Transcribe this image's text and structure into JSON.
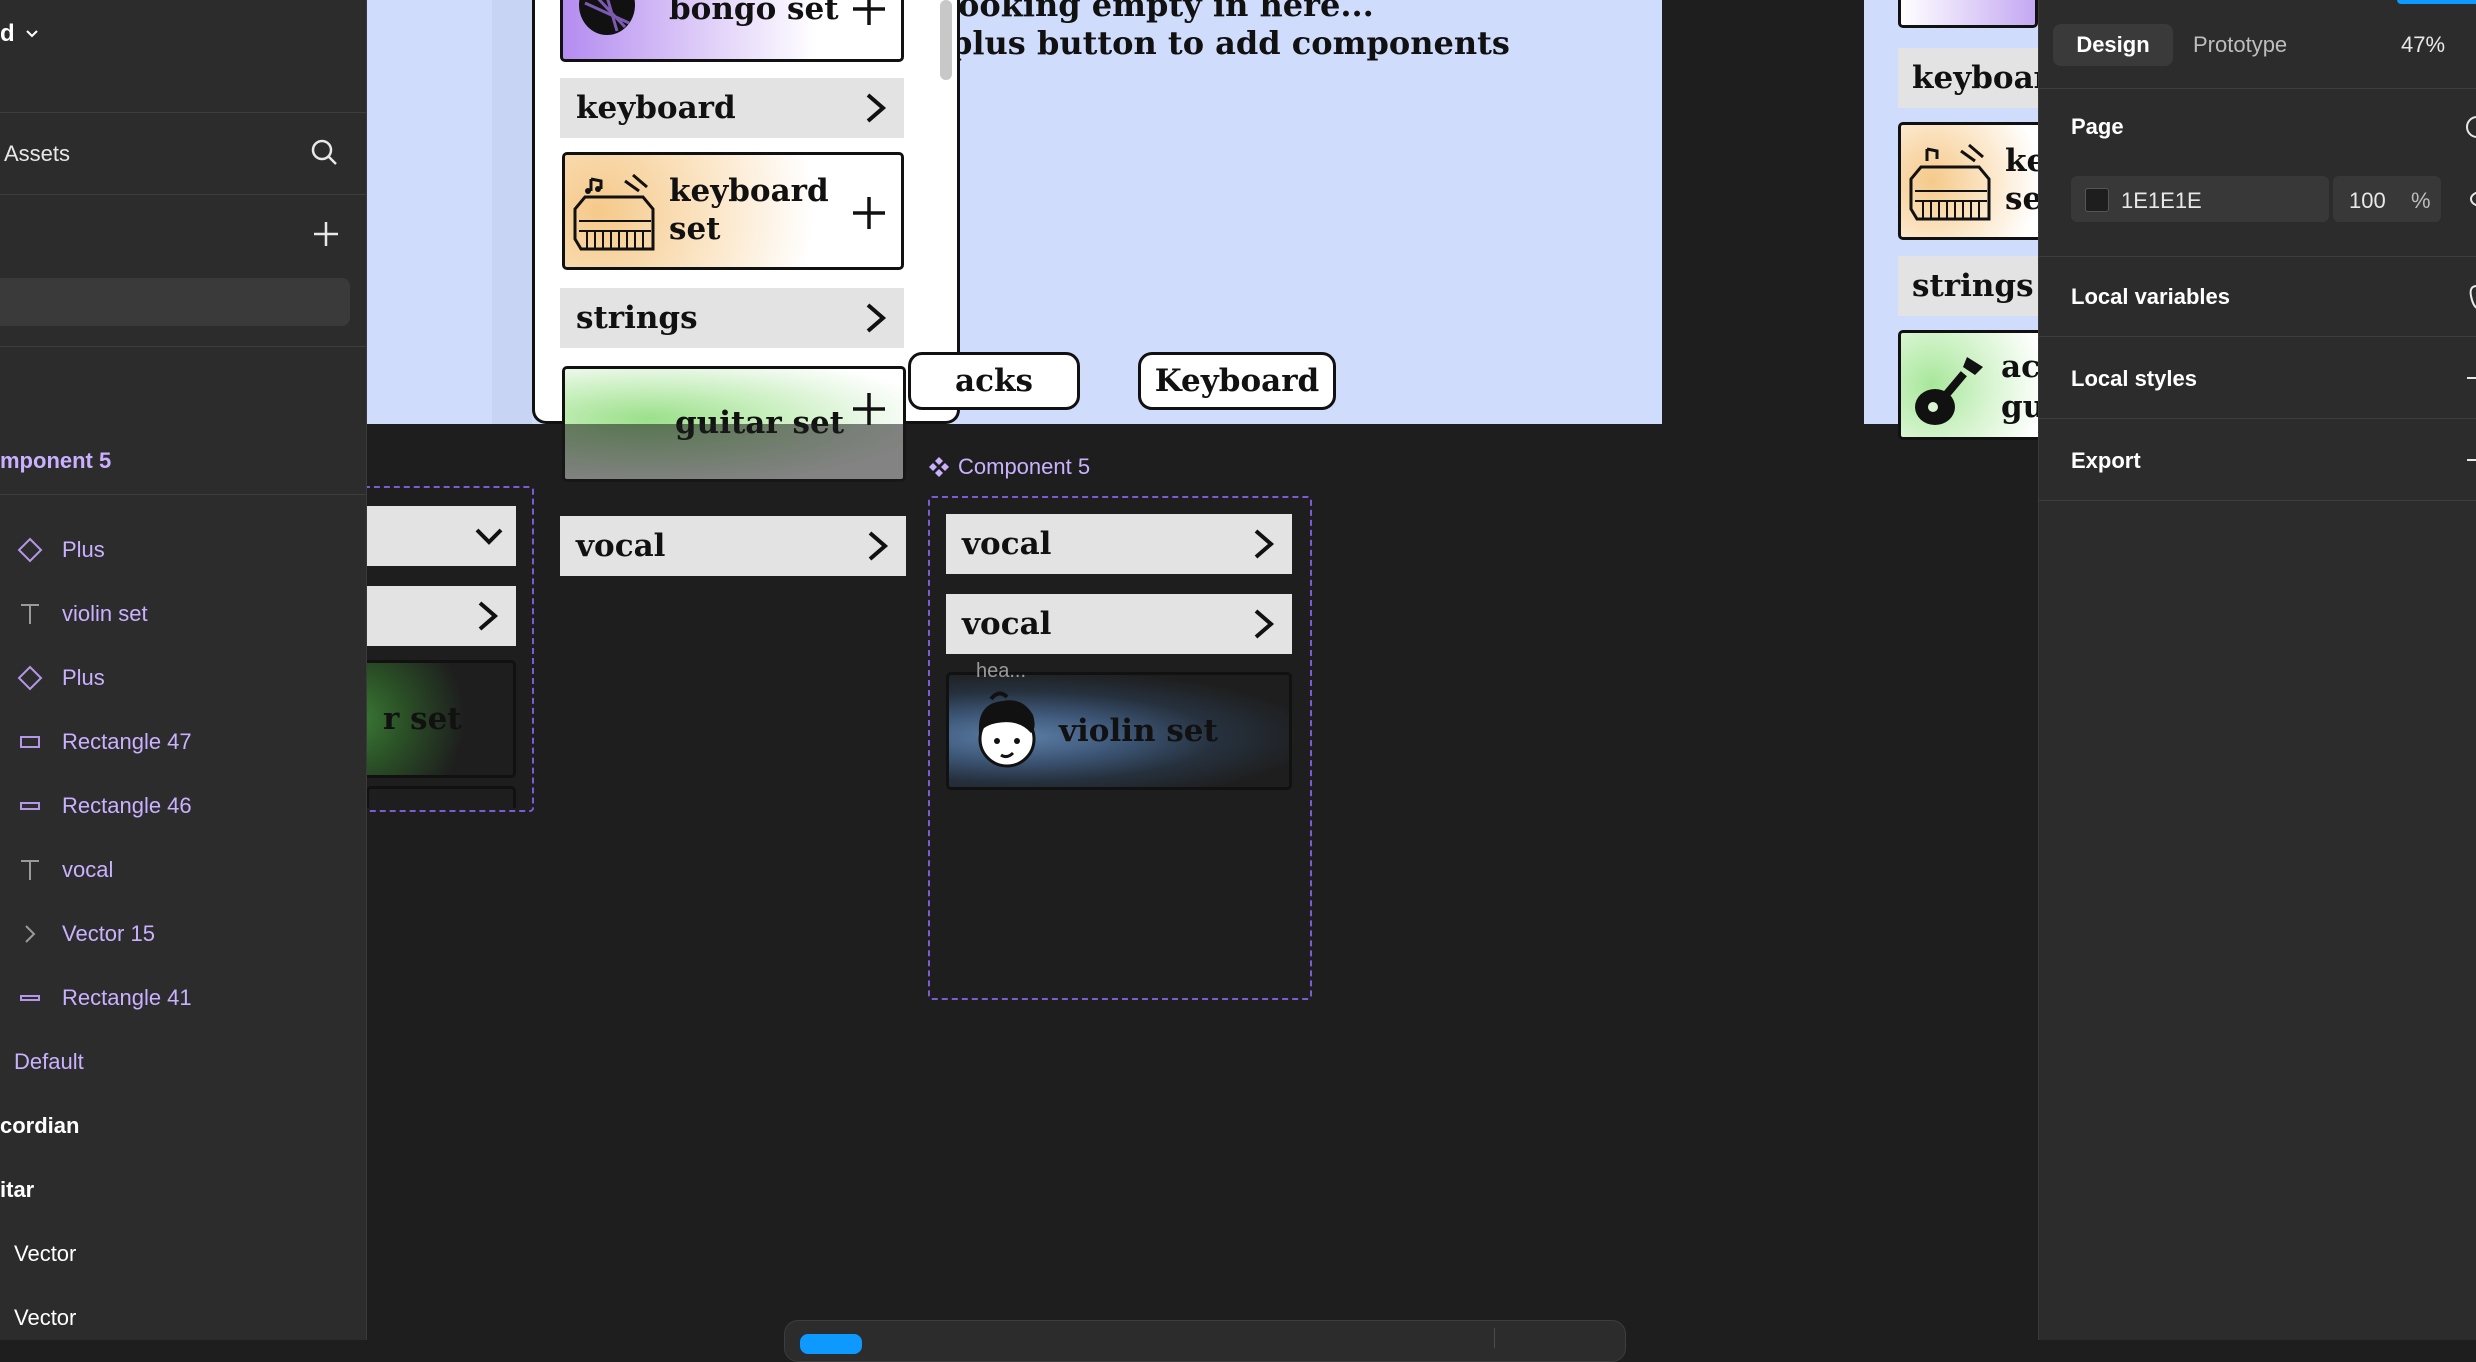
{
  "left_panel": {
    "file_name_fragment": "d",
    "assets_tab": "Assets",
    "component_header": "mponent 5",
    "layers": [
      {
        "icon": "component-instance-icon",
        "label": "Plus"
      },
      {
        "icon": "text-icon",
        "label": "violin set"
      },
      {
        "icon": "component-instance-icon",
        "label": "Plus"
      },
      {
        "icon": "rectangle-icon",
        "label": "Rectangle 47"
      },
      {
        "icon": "rectangle-icon",
        "label": "Rectangle 46"
      },
      {
        "icon": "text-icon",
        "label": "vocal"
      },
      {
        "icon": "vector-icon",
        "label": "Vector 15"
      },
      {
        "icon": "line-icon",
        "label": "Rectangle 41"
      }
    ],
    "variant_default": "Default",
    "group_accordian": "cordian",
    "group_guitar": "itar",
    "vector_1": "Vector",
    "vector_2": "Vector"
  },
  "right_panel": {
    "tab_design": "Design",
    "tab_prototype": "Prototype",
    "zoom": "47%",
    "page_label": "Page",
    "page_color_hex": "1E1E1E",
    "page_opacity": "100",
    "percent_sign": "%",
    "local_variables": "Local variables",
    "local_styles": "Local styles",
    "export": "Export"
  },
  "canvas": {
    "empty_line1": "ooking empty in here...",
    "empty_line2": "plus button to add components",
    "bongo_set": "bongo set",
    "keyboard_bar": "keyboard",
    "keyboard_set": "keyboard set",
    "keyboard_set_l1": "keyboard",
    "keyboard_set_l2": "set",
    "strings_bar": "strings",
    "guitar_set": "guitar set",
    "tracks_pill": "acks",
    "keyboard_pill": "Keyboard",
    "vocal_left": "vocal",
    "left_card_fragment": "r set",
    "component_label": "Component 5",
    "vocal_1": "vocal",
    "vocal_2": "vocal",
    "tooltip_fragment": "hea...",
    "violin_set": "violin set",
    "right_keyboard_fragment": "keyboar",
    "right_keyboard_set_l1": "ke",
    "right_keyboard_set_l2": "se",
    "right_strings": "strings",
    "right_acoustic_l1": "ac",
    "right_acoustic_l2": "gu"
  },
  "colors": {
    "canvas_bg": "#1e1e1e",
    "panel_bg": "#2c2c2c",
    "frame_bg": "#d0dcfb",
    "component_purple": "#c9b1ff",
    "selection_dash": "#7c5bd6",
    "accent_blue": "#0d99ff"
  }
}
